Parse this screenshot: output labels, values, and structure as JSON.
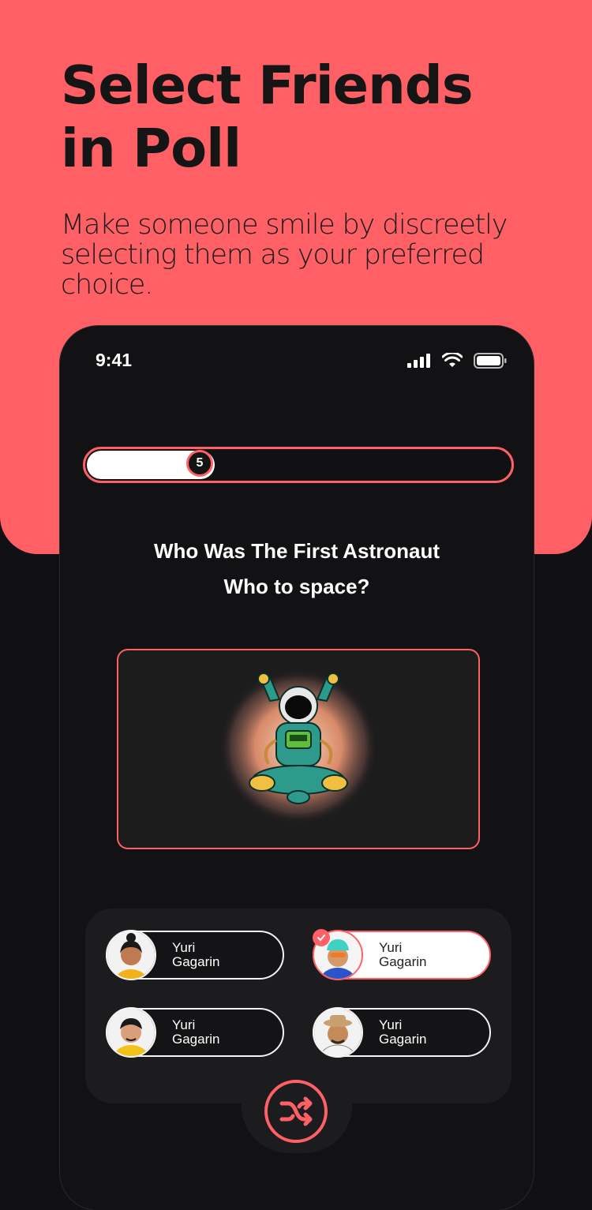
{
  "hero": {
    "title_line1": "Select Friends",
    "title_line2": "in Poll",
    "subtitle": "Make someone smile by discreetly selecting them as your preferred choice."
  },
  "status_bar": {
    "time": "9:41",
    "icons": [
      "signal-icon",
      "wifi-icon",
      "battery-icon"
    ]
  },
  "progress": {
    "value": 5,
    "label": "5",
    "fraction": 0.3
  },
  "question": {
    "line1": "Who Was The First Astronaut",
    "line2": "Who to space?"
  },
  "image": {
    "icon": "astronaut-illustration"
  },
  "options": [
    {
      "line1": "Yuri",
      "line2": "Gagarin",
      "selected": false
    },
    {
      "line1": "Yuri",
      "line2": "Gagarin",
      "selected": true
    },
    {
      "line1": "Yuri",
      "line2": "Gagarin",
      "selected": false
    },
    {
      "line1": "Yuri",
      "line2": "Gagarin",
      "selected": false
    }
  ],
  "shuffle": {
    "icon": "shuffle-icon"
  },
  "colors": {
    "accent": "#ff6065",
    "background": "#111113",
    "panel": "#1c1c1e"
  }
}
